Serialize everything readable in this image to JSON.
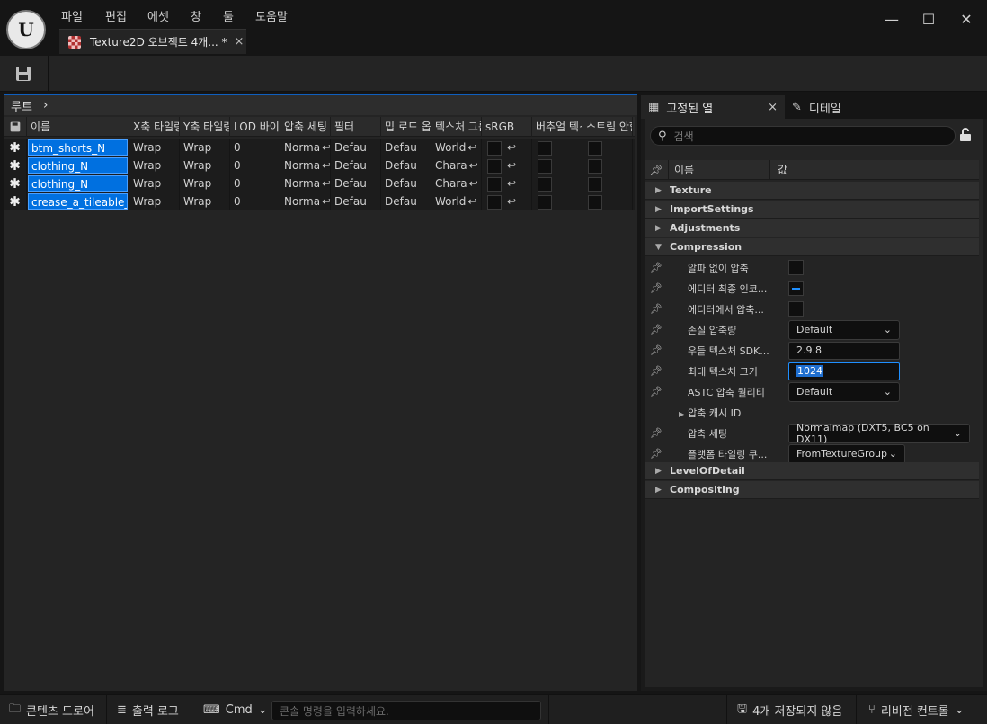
{
  "menu": [
    "파일",
    "편집",
    "에셋",
    "창",
    "툴",
    "도움말"
  ],
  "window_controls": {
    "minimize": "—",
    "maximize": "☐",
    "close": "✕"
  },
  "doc_tab": {
    "title": "Texture2D 오브젝트 4개... *",
    "close": "×"
  },
  "breadcrumb": {
    "root": "루트",
    "chevron": "›"
  },
  "grid": {
    "headers": [
      "이름",
      "X축 타일링",
      "Y축 타일링",
      "LOD 바이어스",
      "압축 세팅",
      "필터",
      "밉 로드 옵션",
      "텍스처 그룹",
      "sRGB",
      "버추얼 텍스처",
      "스트림 안함"
    ],
    "rows": [
      {
        "name": "btm_shorts_N",
        "x_tiling": "Wrap",
        "y_tiling": "Wrap",
        "lod": "0",
        "compression": "Norma",
        "filter": "Defau",
        "mip": "Defau",
        "group": "World"
      },
      {
        "name": "clothing_N",
        "x_tiling": "Wrap",
        "y_tiling": "Wrap",
        "lod": "0",
        "compression": "Norma",
        "filter": "Defau",
        "mip": "Defau",
        "group": "Chara"
      },
      {
        "name": "clothing_N",
        "x_tiling": "Wrap",
        "y_tiling": "Wrap",
        "lod": "0",
        "compression": "Norma",
        "filter": "Defau",
        "mip": "Defau",
        "group": "Chara"
      },
      {
        "name": "crease_a_tileable_N",
        "x_tiling": "Wrap",
        "y_tiling": "Wrap",
        "lod": "0",
        "compression": "Norma",
        "filter": "Defau",
        "mip": "Defau",
        "group": "World"
      }
    ]
  },
  "right_panel": {
    "tab_pinned": "고정된 열",
    "tab_details": "디테일",
    "search_placeholder": "검색",
    "header_name": "이름",
    "header_value": "값",
    "categories": {
      "texture": "Texture",
      "import": "ImportSettings",
      "adjustments": "Adjustments",
      "compression": "Compression",
      "lod": "LevelOfDetail",
      "compositing": "Compositing"
    },
    "props": {
      "alpha": "알파 없이 압축",
      "editor_final": "에디터 최종 인코...",
      "editor_compress": "에디터에서 압축...",
      "lossy": "손실 압축량",
      "lossy_val": "Default",
      "oodle": "우들 텍스처 SDK...",
      "oodle_val": "2.9.8",
      "max_size": "최대 텍스처 크기",
      "max_size_val": "1024",
      "astc": "ASTC 압축 퀄리티",
      "astc_val": "Default",
      "cache_id": "압축 캐시 ID",
      "comp_settings": "압축 세팅",
      "comp_settings_val": "Normalmap (DXT5, BC5 on DX11)",
      "platform_tiling": "플랫폼 타일링 쿠...",
      "platform_tiling_val": "FromTextureGroup"
    }
  },
  "statusbar": {
    "content_drawer": "콘텐츠 드로어",
    "output_log": "출력 로그",
    "cmd": "Cmd",
    "console_placeholder": "콘솔 명령을 입력하세요.",
    "unsaved": "4개 저장되지 않음",
    "revision": "리비전 컨트롤"
  }
}
